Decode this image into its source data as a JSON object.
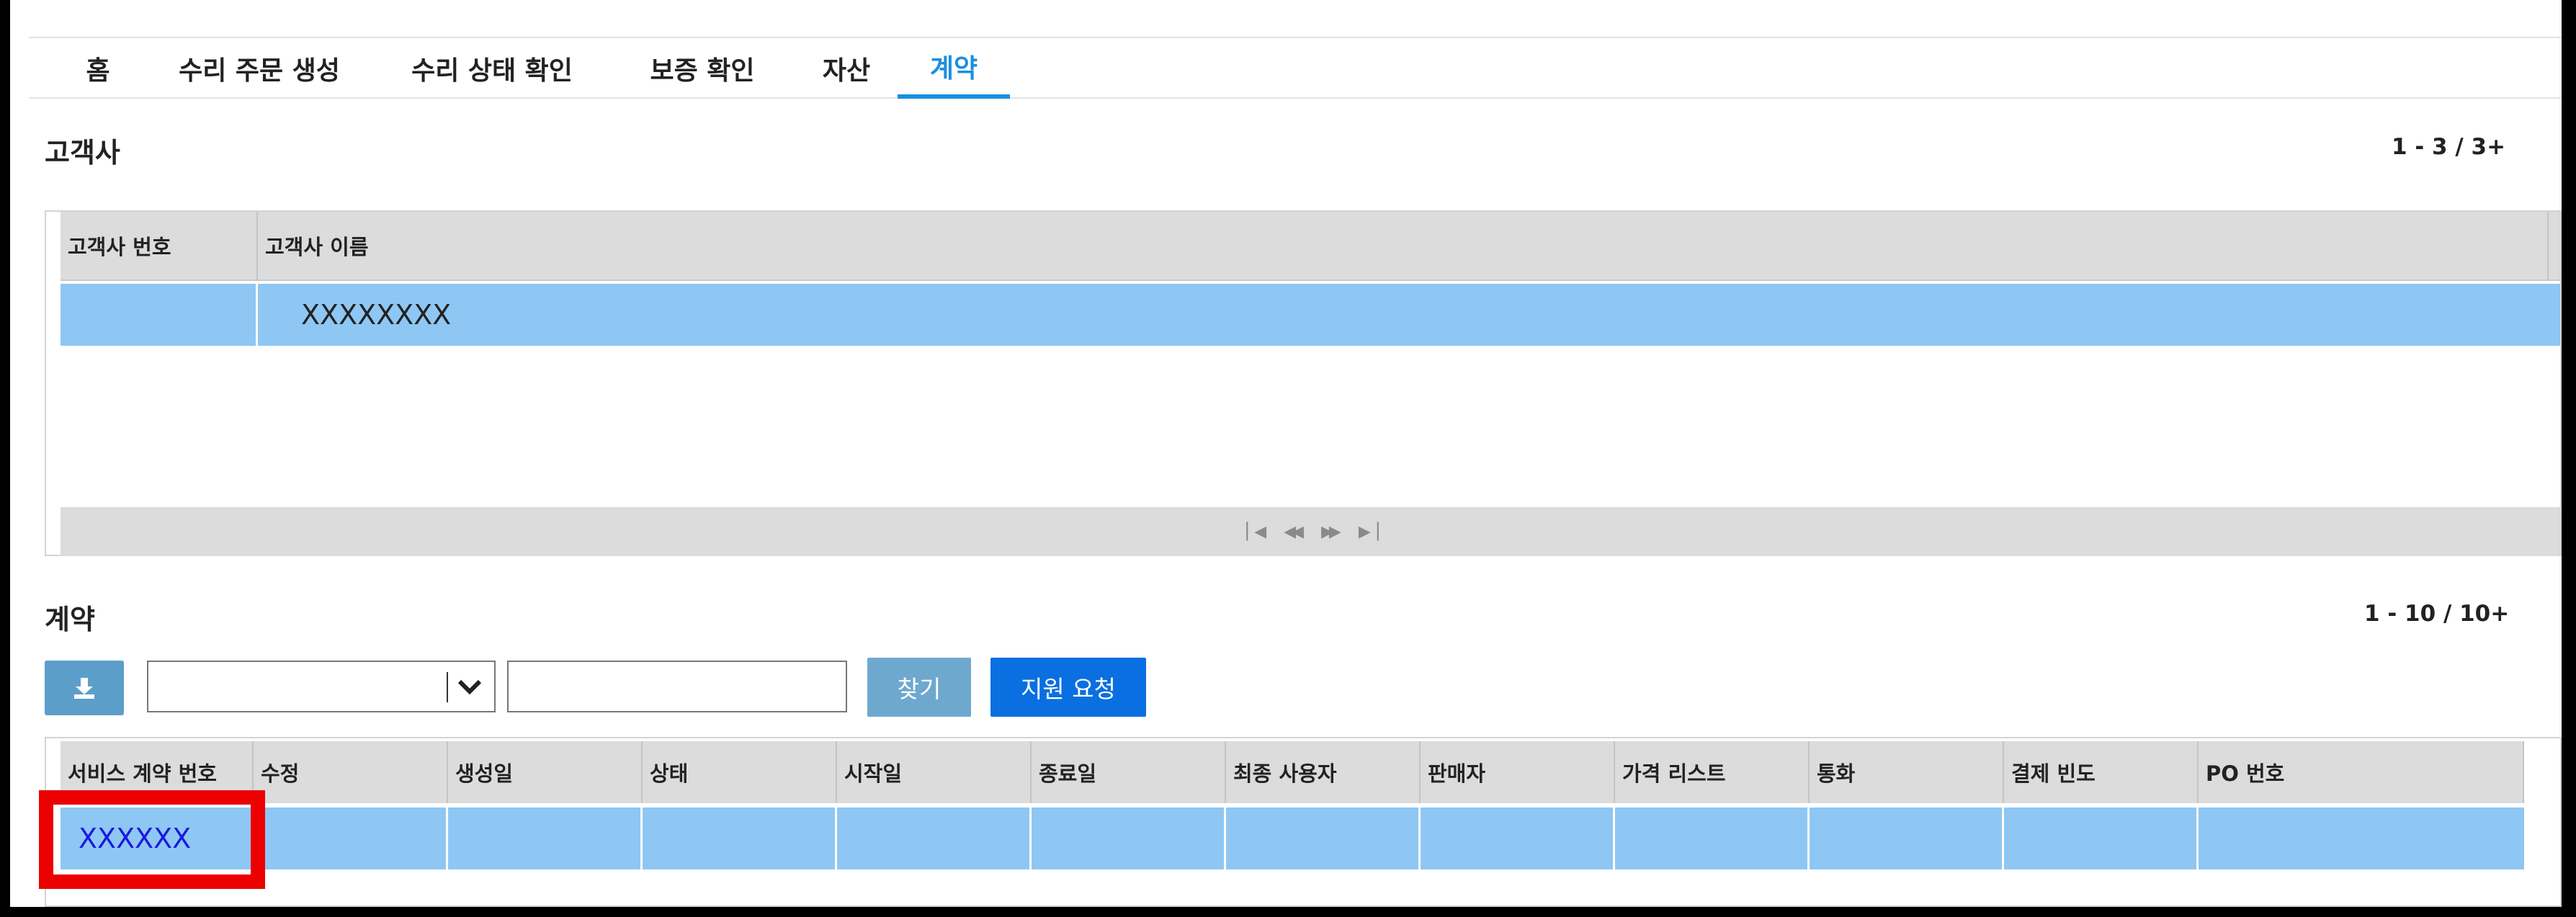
{
  "tabs": [
    {
      "label": "홈"
    },
    {
      "label": "수리 주문 생성"
    },
    {
      "label": "수리 상태 확인"
    },
    {
      "label": "보증 확인"
    },
    {
      "label": "자산"
    },
    {
      "label": "계약"
    }
  ],
  "customers": {
    "title": "고객사",
    "count": "1 - 3 / 3+",
    "columns": [
      "고객사 번호",
      "고객사 이름"
    ],
    "rows": [
      {
        "number": "",
        "name": "XXXXXXXX"
      }
    ],
    "pager": [
      "first-page-icon",
      "prev-page-icon",
      "next-page-icon",
      "last-page-icon"
    ]
  },
  "contracts": {
    "title": "계약",
    "count": "1 - 10 / 10+",
    "search_select_value": "",
    "search_text_value": "",
    "find_label": "찾기",
    "support_label": "지원 요청",
    "columns": [
      "서비스 계약 번호",
      "수정",
      "생성일",
      "상태",
      "시작일",
      "종료일",
      "최종 사용자",
      "판매자",
      "가격 리스트",
      "통화",
      "결제 빈도",
      "PO 번호"
    ],
    "rows": [
      {
        "contract_no": "XXXXXX"
      }
    ]
  },
  "colors": {
    "accent": "#1a8fe0",
    "selected_row": "#8ec7f3",
    "primary_button": "#0a6fe0",
    "secondary_button": "#6fa8cf",
    "highlight": "#ec0000"
  }
}
